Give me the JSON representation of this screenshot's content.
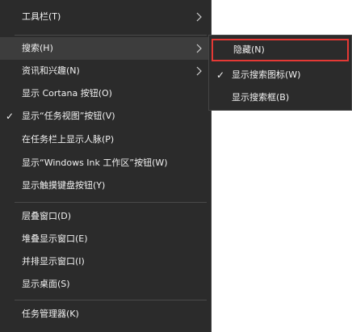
{
  "menu": {
    "items": [
      {
        "label": "工具栏(T)",
        "has_submenu": true,
        "checked": false
      },
      {
        "label": "搜索(H)",
        "has_submenu": true,
        "checked": false,
        "highlighted": true
      },
      {
        "label": "资讯和兴趣(N)",
        "has_submenu": true,
        "checked": false
      },
      {
        "label": "显示 Cortana 按钮(O)",
        "has_submenu": false,
        "checked": false
      },
      {
        "label": "显示“任务视图”按钮(V)",
        "has_submenu": false,
        "checked": true
      },
      {
        "label": "在任务栏上显示人脉(P)",
        "has_submenu": false,
        "checked": false
      },
      {
        "label": "显示“Windows Ink 工作区”按钮(W)",
        "has_submenu": false,
        "checked": false
      },
      {
        "label": "显示触摸键盘按钮(Y)",
        "has_submenu": false,
        "checked": false
      },
      {
        "label": "层叠窗口(D)",
        "has_submenu": false,
        "checked": false
      },
      {
        "label": "堆叠显示窗口(E)",
        "has_submenu": false,
        "checked": false
      },
      {
        "label": "并排显示窗口(I)",
        "has_submenu": false,
        "checked": false
      },
      {
        "label": "显示桌面(S)",
        "has_submenu": false,
        "checked": false
      },
      {
        "label": "任务管理器(K)",
        "has_submenu": false,
        "checked": false
      }
    ],
    "check_glyph": "✓"
  },
  "submenu": {
    "items": [
      {
        "label": "隐藏(N)",
        "checked": false,
        "outlined": true
      },
      {
        "label": "显示搜索图标(W)",
        "checked": true
      },
      {
        "label": "显示搜索框(B)",
        "checked": false
      }
    ]
  },
  "colors": {
    "menu_background": "#2b2b2b",
    "highlight": "#3d3d3d",
    "text": "#f2f2f2",
    "outline": "#e53935"
  }
}
